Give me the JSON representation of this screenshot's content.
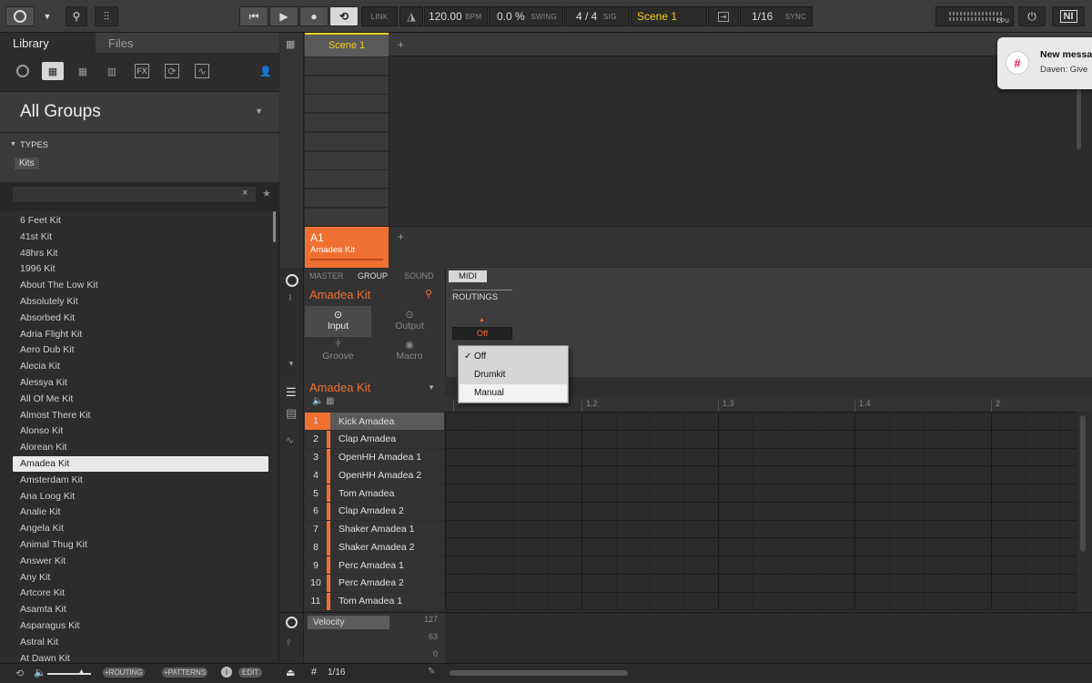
{
  "transport": {
    "link": "LINK",
    "bpm_value": "120.00",
    "bpm_label": "BPM",
    "swing_value": "0.0 %",
    "swing_label": "SWING",
    "sig_value": "4 / 4",
    "sig_label": "SIG",
    "scene": "Scene 1",
    "quant": "1/16",
    "sync_label": "SYNC",
    "cpu_label": "CPU"
  },
  "library": {
    "tabs": [
      "Library",
      "Files"
    ],
    "header": "All Groups",
    "types_label": "TYPES",
    "type_tag": "Kits",
    "items": [
      "6 Feet Kit",
      "41st Kit",
      "48hrs Kit",
      "1996 Kit",
      "About The Low Kit",
      "Absolutely Kit",
      "Absorbed Kit",
      "Adria Flight Kit",
      "Aero Dub Kit",
      "Alecia Kit",
      "Alessya Kit",
      "All Of Me Kit",
      "Almost There Kit",
      "Alonso Kit",
      "Alorean Kit",
      "Amadea Kit",
      "Amsterdam Kit",
      "Ana Loog Kit",
      "Analie Kit",
      "Angela Kit",
      "Animal Thug Kit",
      "Answer Kit",
      "Any Kit",
      "Artcore Kit",
      "Asamta Kit",
      "Asparagus Kit",
      "Astral Kit",
      "At Dawn Kit"
    ],
    "selected_index": 15,
    "footer": {
      "routing": "+ROUTING",
      "patterns": "+PATTERNS",
      "info": "i",
      "edit": "EDIT"
    }
  },
  "arranger": {
    "scene_tab": "Scene 1",
    "add": "+",
    "group_slot": "A1",
    "group_name": "Amadea Kit"
  },
  "control": {
    "tabs": [
      "MASTER",
      "GROUP",
      "SOUND"
    ],
    "active_tab": "GROUP",
    "group_name": "Amadea Kit",
    "pages": [
      "Input",
      "Output",
      "Groove",
      "Macro"
    ],
    "midi_tab": "MIDI",
    "routings_label": "ROUTINGS",
    "routing_value": "Off",
    "menu_options": [
      "Off",
      "Drumkit",
      "Manual"
    ],
    "menu_checked": "Off"
  },
  "pattern": {
    "group_name": "Amadea Kit",
    "ruler": [
      "1.2",
      "1.3",
      "1.4",
      "2"
    ],
    "sounds": [
      {
        "num": "1",
        "name": "Kick Amadea"
      },
      {
        "num": "2",
        "name": "Clap Amadea"
      },
      {
        "num": "3",
        "name": "OpenHH Amadea 1"
      },
      {
        "num": "4",
        "name": "OpenHH Amadea 2"
      },
      {
        "num": "5",
        "name": "Tom Amadea"
      },
      {
        "num": "6",
        "name": "Clap Amadea 2"
      },
      {
        "num": "7",
        "name": "Shaker Amadea 1"
      },
      {
        "num": "8",
        "name": "Shaker Amadea 2"
      },
      {
        "num": "9",
        "name": "Perc Amadea 1"
      },
      {
        "num": "10",
        "name": "Perc Amadea 2"
      },
      {
        "num": "11",
        "name": "Tom Amadea 1"
      }
    ],
    "velocity_label": "Velocity",
    "velocity_scale": [
      "127",
      "63",
      "0"
    ],
    "footer_quant": "1/16"
  },
  "notification": {
    "title": "New messa",
    "body": "Daven: Give"
  }
}
